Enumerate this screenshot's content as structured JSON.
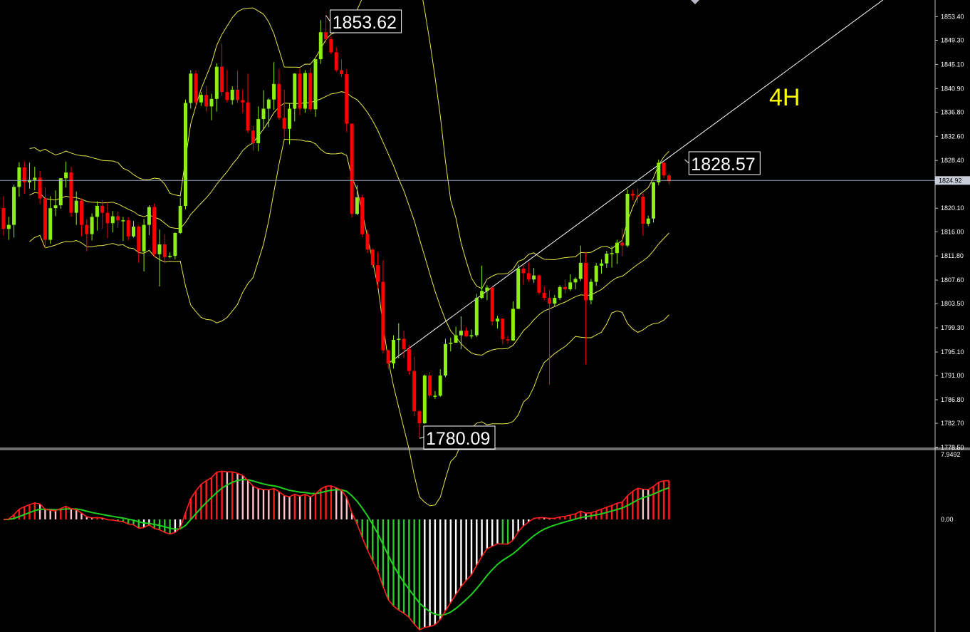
{
  "timeframe_label": "4H",
  "chart_data": {
    "type": "candlestick",
    "price_axis": {
      "ticks": [
        "1853.40",
        "1849.30",
        "1845.10",
        "1840.90",
        "1836.80",
        "1832.60",
        "1828.40",
        "1824.92",
        "1820.10",
        "1816.00",
        "1811.80",
        "1807.60",
        "1803.50",
        "1799.30",
        "1795.10",
        "1791.00",
        "1786.80",
        "1782.70",
        "1778.50"
      ],
      "range": [
        1778.5,
        1856.3
      ],
      "current_price": 1824.92
    },
    "annotations": [
      {
        "text": "1853.62",
        "price": 1853.62
      },
      {
        "text": "1828.57",
        "price": 1828.57
      },
      {
        "text": "1780.09",
        "price": 1780.09
      }
    ],
    "colors": {
      "bull": "#8cf014",
      "bear": "#ff0000",
      "bands": "#e6e64b",
      "trendline": "#ffffff",
      "macd_line": "#ff2020",
      "signal_line": "#20d020",
      "hist_up_strong": "#ff1c1c",
      "hist_up_weak": "#ffc0c8",
      "hist_down_strong": "#32c832",
      "hist_down_weak": "#ffffff"
    },
    "candles": [
      [
        1820.12,
        1822.2,
        1815.3,
        1816.5
      ],
      [
        1816.5,
        1818.6,
        1814.6,
        1817.2
      ],
      [
        1817.2,
        1824.2,
        1815.0,
        1823.8
      ],
      [
        1823.8,
        1828.1,
        1822.1,
        1827.2
      ],
      [
        1827.2,
        1828.2,
        1822.6,
        1824.6
      ],
      [
        1824.6,
        1828.0,
        1823.5,
        1825.0
      ],
      [
        1825.0,
        1827.3,
        1823.2,
        1825.4
      ],
      [
        1825.4,
        1826.6,
        1820.8,
        1821.8
      ],
      [
        1821.8,
        1823.7,
        1813.1,
        1814.6
      ],
      [
        1814.6,
        1822.2,
        1813.9,
        1820.1
      ],
      [
        1820.1,
        1823.2,
        1818.7,
        1820.6
      ],
      [
        1820.6,
        1825.3,
        1820.0,
        1825.3
      ],
      [
        1825.3,
        1828.2,
        1823.7,
        1826.3
      ],
      [
        1826.3,
        1827.3,
        1818.6,
        1819.3
      ],
      [
        1819.3,
        1823.0,
        1817.2,
        1821.4
      ],
      [
        1821.4,
        1821.8,
        1815.2,
        1817.2
      ],
      [
        1817.2,
        1818.2,
        1812.6,
        1815.6
      ],
      [
        1815.6,
        1819.2,
        1814.5,
        1818.6
      ],
      [
        1818.6,
        1821.3,
        1816.2,
        1820.5
      ],
      [
        1820.5,
        1821.5,
        1816.5,
        1819.3
      ],
      [
        1819.3,
        1821.2,
        1814.9,
        1817.5
      ],
      [
        1817.5,
        1819.6,
        1815.9,
        1818.7
      ],
      [
        1818.7,
        1819.5,
        1816.7,
        1818.0
      ],
      [
        1818.0,
        1818.6,
        1814.4,
        1818.0
      ],
      [
        1818.0,
        1818.5,
        1814.5,
        1815.2
      ],
      [
        1815.2,
        1817.9,
        1815.0,
        1816.9
      ],
      [
        1816.9,
        1817.2,
        1810.6,
        1812.6
      ],
      [
        1812.6,
        1818.2,
        1809.1,
        1817.2
      ],
      [
        1817.2,
        1820.6,
        1815.4,
        1820.3
      ],
      [
        1820.3,
        1820.9,
        1811.6,
        1812.1
      ],
      [
        1812.1,
        1816.4,
        1806.5,
        1813.8
      ],
      [
        1813.8,
        1815.6,
        1810.8,
        1811.6
      ],
      [
        1811.6,
        1812.4,
        1811.4,
        1811.8
      ],
      [
        1811.8,
        1815.9,
        1811.2,
        1815.8
      ],
      [
        1815.8,
        1821.9,
        1815.6,
        1820.5
      ],
      [
        1820.5,
        1839.0,
        1819.9,
        1838.4
      ],
      [
        1838.4,
        1844.1,
        1837.4,
        1843.5
      ],
      [
        1843.5,
        1844.1,
        1837.6,
        1838.5
      ],
      [
        1838.5,
        1840.3,
        1837.9,
        1839.8
      ],
      [
        1839.8,
        1841.3,
        1836.9,
        1837.8
      ],
      [
        1837.8,
        1840.0,
        1835.4,
        1839.1
      ],
      [
        1839.1,
        1845.3,
        1836.9,
        1844.7
      ],
      [
        1844.7,
        1848.7,
        1839.6,
        1840.3
      ],
      [
        1840.3,
        1844.1,
        1838.5,
        1838.9
      ],
      [
        1838.9,
        1841.3,
        1838.1,
        1840.7
      ],
      [
        1840.7,
        1844.0,
        1838.4,
        1838.9
      ],
      [
        1838.9,
        1840.8,
        1836.7,
        1838.5
      ],
      [
        1838.5,
        1843.5,
        1833.2,
        1833.6
      ],
      [
        1833.6,
        1834.4,
        1830.1,
        1831.4
      ],
      [
        1831.4,
        1837.8,
        1830.0,
        1835.6
      ],
      [
        1835.6,
        1840.6,
        1833.9,
        1837.4
      ],
      [
        1837.4,
        1839.2,
        1834.2,
        1839.0
      ],
      [
        1839.0,
        1845.5,
        1837.2,
        1841.7
      ],
      [
        1841.7,
        1844.3,
        1835.5,
        1835.8
      ],
      [
        1835.8,
        1840.7,
        1832.4,
        1833.9
      ],
      [
        1833.9,
        1838.3,
        1831.2,
        1837.4
      ],
      [
        1837.4,
        1843.6,
        1835.2,
        1843.5
      ],
      [
        1843.5,
        1844.4,
        1836.3,
        1837.4
      ],
      [
        1837.4,
        1844.1,
        1836.7,
        1843.6
      ],
      [
        1843.6,
        1844.5,
        1836.9,
        1837.3
      ],
      [
        1837.3,
        1846.0,
        1836.0,
        1846.0
      ],
      [
        1846.0,
        1852.8,
        1845.2,
        1850.7
      ],
      [
        1850.7,
        1853.62,
        1848.8,
        1849.5
      ],
      [
        1849.5,
        1849.9,
        1846.9,
        1847.2
      ],
      [
        1847.2,
        1848.1,
        1843.8,
        1844.1
      ],
      [
        1844.1,
        1846.0,
        1842.9,
        1843.4
      ],
      [
        1843.4,
        1844.3,
        1833.3,
        1834.8
      ],
      [
        1834.8,
        1834.8,
        1818.5,
        1819.1
      ],
      [
        1819.1,
        1824.1,
        1818.9,
        1822.0
      ],
      [
        1822.0,
        1822.4,
        1815.1,
        1815.6
      ],
      [
        1815.6,
        1816.4,
        1812.3,
        1812.9
      ],
      [
        1812.9,
        1813.1,
        1809.7,
        1810.2
      ],
      [
        1810.2,
        1812.5,
        1806.2,
        1807.3
      ],
      [
        1807.3,
        1811.0,
        1794.8,
        1795.4
      ],
      [
        1795.4,
        1795.5,
        1792.2,
        1793.1
      ],
      [
        1793.1,
        1798.0,
        1792.2,
        1797.2
      ],
      [
        1797.2,
        1800.1,
        1794.0,
        1797.4
      ],
      [
        1797.4,
        1798.8,
        1794.1,
        1795.6
      ],
      [
        1795.6,
        1796.3,
        1791.2,
        1791.8
      ],
      [
        1791.8,
        1794.3,
        1783.9,
        1784.8
      ],
      [
        1784.8,
        1785.0,
        1780.09,
        1782.7
      ],
      [
        1782.7,
        1791.2,
        1782.6,
        1791.0
      ],
      [
        1791.0,
        1791.6,
        1787.2,
        1787.5
      ],
      [
        1787.5,
        1788.3,
        1786.9,
        1787.5
      ],
      [
        1787.5,
        1792.1,
        1787.3,
        1791.0
      ],
      [
        1791.0,
        1797.4,
        1790.7,
        1796.5
      ],
      [
        1796.5,
        1797.6,
        1795.2,
        1796.7
      ],
      [
        1796.7,
        1799.5,
        1797.5,
        1798.0
      ],
      [
        1798.0,
        1801.3,
        1795.6,
        1798.8
      ],
      [
        1798.8,
        1799.4,
        1797.7,
        1797.8
      ],
      [
        1797.8,
        1799.0,
        1797.4,
        1798.0
      ],
      [
        1798.0,
        1805.2,
        1797.7,
        1804.5
      ],
      [
        1804.5,
        1810.1,
        1804.3,
        1805.7
      ],
      [
        1805.7,
        1806.7,
        1804.1,
        1806.3
      ],
      [
        1806.3,
        1806.4,
        1799.7,
        1800.4
      ],
      [
        1800.4,
        1801.4,
        1799.2,
        1800.9
      ],
      [
        1800.9,
        1800.9,
        1796.5,
        1797.3
      ],
      [
        1797.3,
        1797.9,
        1796.6,
        1797.1
      ],
      [
        1797.1,
        1803.9,
        1797.0,
        1802.6
      ],
      [
        1802.6,
        1810.3,
        1802.6,
        1809.6
      ],
      [
        1809.6,
        1810.2,
        1806.8,
        1808.8
      ],
      [
        1808.8,
        1810.6,
        1807.3,
        1807.7
      ],
      [
        1807.7,
        1809.7,
        1807.1,
        1808.4
      ],
      [
        1808.4,
        1808.6,
        1805.1,
        1805.4
      ],
      [
        1805.4,
        1806.5,
        1804.1,
        1804.5
      ],
      [
        1804.5,
        1805.9,
        1789.4,
        1803.5
      ],
      [
        1803.5,
        1805.0,
        1803.1,
        1804.5
      ],
      [
        1804.5,
        1806.7,
        1804.1,
        1806.4
      ],
      [
        1806.4,
        1807.6,
        1805.3,
        1806.0
      ],
      [
        1806.0,
        1808.6,
        1805.7,
        1807.2
      ],
      [
        1807.2,
        1808.1,
        1806.0,
        1807.8
      ],
      [
        1807.8,
        1813.6,
        1807.4,
        1810.6
      ],
      [
        1810.6,
        1812.4,
        1793.0,
        1804.1
      ],
      [
        1804.1,
        1807.8,
        1803.4,
        1807.3
      ],
      [
        1807.3,
        1810.6,
        1806.6,
        1810.1
      ],
      [
        1810.1,
        1811.2,
        1808.7,
        1810.5
      ],
      [
        1810.5,
        1812.7,
        1809.7,
        1812.2
      ],
      [
        1812.2,
        1813.5,
        1809.8,
        1812.3
      ],
      [
        1812.3,
        1814.6,
        1810.4,
        1814.1
      ],
      [
        1814.1,
        1816.5,
        1811.8,
        1813.6
      ],
      [
        1813.6,
        1823.4,
        1813.3,
        1822.6
      ],
      [
        1822.6,
        1823.3,
        1821.5,
        1822.3
      ],
      [
        1822.3,
        1823.5,
        1821.0,
        1822.1
      ],
      [
        1822.1,
        1822.7,
        1815.3,
        1817.4
      ],
      [
        1817.4,
        1818.8,
        1817.0,
        1818.3
      ],
      [
        1818.3,
        1824.7,
        1817.6,
        1824.6
      ],
      [
        1824.6,
        1828.57,
        1824.1,
        1828.0
      ],
      [
        1828.0,
        1828.1,
        1825.3,
        1825.8
      ],
      [
        1825.8,
        1826.1,
        1824.3,
        1824.8
      ]
    ],
    "macd": {
      "zero_label": "0.00",
      "max_label": "7.9492",
      "max_value": 7.9492
    }
  }
}
